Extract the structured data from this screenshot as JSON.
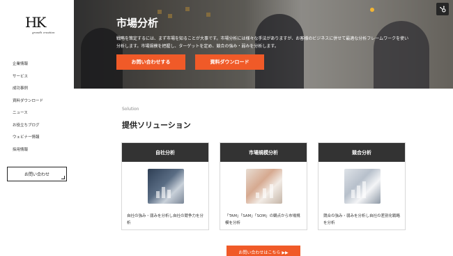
{
  "logo": {
    "mark": "HK",
    "sub": "growth creation"
  },
  "sidebar": {
    "items": [
      {
        "label": "企業情報"
      },
      {
        "label": "サービス"
      },
      {
        "label": "成功事例"
      },
      {
        "label": "資料ダウンロード"
      },
      {
        "label": "ニュース"
      },
      {
        "label": "お役立ちブログ"
      },
      {
        "label": "ウェビナー情報"
      },
      {
        "label": "採用情報"
      }
    ],
    "contact_label": "お問い合わせ"
  },
  "hero": {
    "title": "市場分析",
    "description": "戦略を策定するには、まず市場を知ることが大事です。市場分析には様々な手法がありますが、お客様のビジネスに併せて最適な分析フレームワークを使い分析します。市場規模を把握し、ターゲットを定め、競合の強み・弱みを分析します。",
    "primary_button": "お問い合わせする",
    "secondary_button": "資料ダウンロード",
    "accent_color": "#f05a28"
  },
  "solution": {
    "label": "Solution",
    "title": "提供ソリューション",
    "cards": [
      {
        "title": "自社分析",
        "text": "自社の強み・弱みを分析し自社の競争力を分析",
        "icon": "laptop-analysis-image"
      },
      {
        "title": "市場規模分析",
        "text": "「TAM」「SAM」「SOM」の観点から市場規模を分析",
        "icon": "charts-documents-image"
      },
      {
        "title": "競合分析",
        "text": "競合の強み・弱みを分析し自社の差別化戦略を分析",
        "icon": "laptop-graph-image"
      }
    ],
    "cta": "お問い合わせはこちら ▶▶"
  },
  "widget": {
    "icon": "hubspot-icon"
  }
}
